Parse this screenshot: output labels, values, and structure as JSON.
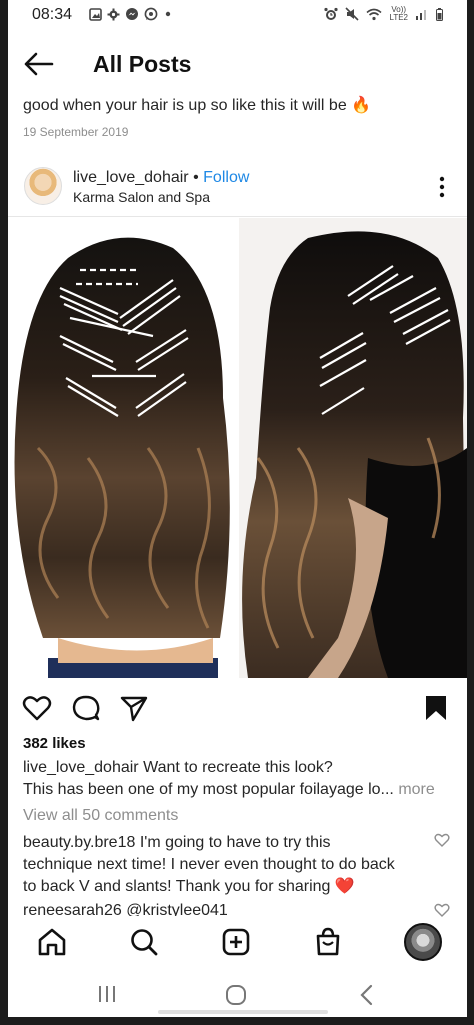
{
  "status": {
    "time": "08:34",
    "network": "LTE2",
    "volte": "Vo))"
  },
  "header": {
    "title": "All Posts"
  },
  "top_caption": {
    "text": "good when your hair is up so like this it will be",
    "emoji": "🔥",
    "date": "19 September 2019"
  },
  "post": {
    "username": "live_love_dohair",
    "separator": "•",
    "follow_label": "Follow",
    "location": "Karma Salon and Spa",
    "likes": "382 likes",
    "caption_user": "live_love_dohair",
    "caption_line1": "Want to recreate this look?",
    "caption_line2": "This has been one of my most popular foilayage lo...",
    "more_label": " more",
    "view_all": "View all 50 comments"
  },
  "comments": [
    {
      "user": "beauty.by.bre18",
      "line1": "I'm going to have to try this",
      "line2": "technique next time! I never even thought to do back",
      "line3": "to back V and slants! Thank you for sharing",
      "emoji": "❤️"
    },
    {
      "user": "reneesarah26",
      "mention": "@kristylee041"
    }
  ],
  "icons": {
    "status": [
      "image-icon",
      "settings-icon",
      "messenger-icon",
      "whatsapp-icon",
      "dot-icon",
      "alarm-icon",
      "mute-icon",
      "wifi-icon",
      "signal-icon",
      "battery-icon"
    ],
    "actions": [
      "heart-icon",
      "comment-icon",
      "share-icon",
      "bookmark-icon"
    ],
    "nav": [
      "home-icon",
      "search-icon",
      "add-post-icon",
      "shop-icon",
      "profile-avatar"
    ]
  },
  "colors": {
    "link_blue": "#1e88e5",
    "muted": "#8e8e8e",
    "heart_red": "#e53935"
  }
}
